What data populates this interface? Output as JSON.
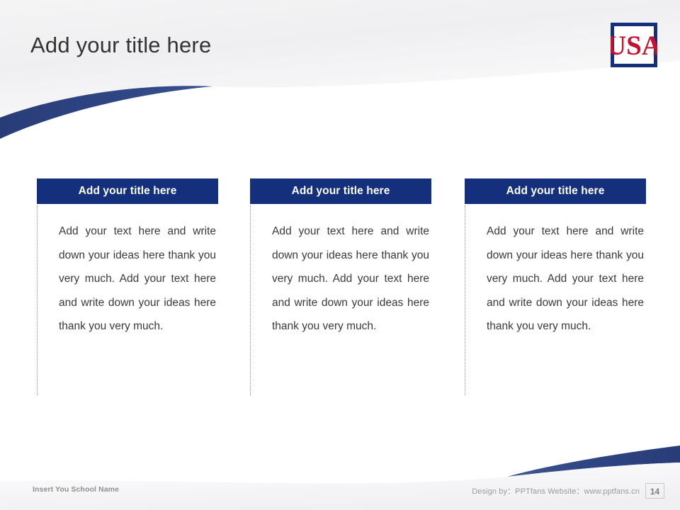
{
  "slide": {
    "title": "Add your title here",
    "page_number": "14",
    "accent_navy": "#14307c",
    "logo_red": "#c8102e",
    "background": "#ffffff"
  },
  "logo": {
    "name": "usa-logo",
    "text": "USA"
  },
  "columns": [
    {
      "header": "Add your title here",
      "body": "Add your text here and write down your ideas here thank you very much. Add your text here and write down your ideas here thank you very much."
    },
    {
      "header": "Add your title here",
      "body": "Add your text here and write down your ideas here thank you very much. Add your text here and write down your ideas here thank you very much."
    },
    {
      "header": "Add your title here",
      "body": "Add your text here and write down your ideas here thank you very much. Add your text here and write down your ideas here thank you very much."
    }
  ],
  "footer": {
    "school_name": "Insert You School Name",
    "credit": "Design by：PPTfans  Website：www.pptfans.cn"
  }
}
